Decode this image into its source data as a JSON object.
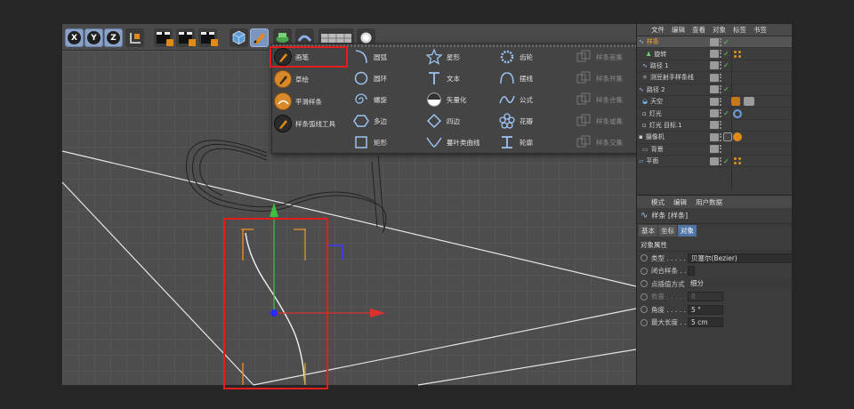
{
  "toolbar": {
    "axis_x": "X",
    "axis_y": "Y",
    "axis_z": "Z"
  },
  "spline_menu": {
    "col1": [
      "画笔",
      "草绘",
      "平滑样条",
      "样条弧线工具"
    ],
    "col2": [
      "圆弧",
      "圆环",
      "螺旋",
      "多边",
      "矩形"
    ],
    "col3": [
      "星形",
      "文本",
      "矢量化",
      "四边",
      "蔓叶类曲线"
    ],
    "col4": [
      "齿轮",
      "摆线",
      "公式",
      "花瓣",
      "轮廓"
    ],
    "col5": [
      "样条差集",
      "样条并集",
      "样条合集",
      "样条或集",
      "样条交集"
    ]
  },
  "object_manager": {
    "tabs": [
      "文件",
      "编辑",
      "查看",
      "对象",
      "标签",
      "书签"
    ],
    "objects": [
      {
        "name": "样条",
        "selected": true
      },
      {
        "name": "旋转"
      },
      {
        "name": "路径 1"
      },
      {
        "name": "测豆射手样条线"
      },
      {
        "name": "路径 2"
      },
      {
        "name": "天空"
      },
      {
        "name": "灯光"
      },
      {
        "name": "灯光 目标.1"
      },
      {
        "name": "摄像机"
      },
      {
        "name": "背景"
      },
      {
        "name": "平面"
      }
    ]
  },
  "attributes": {
    "tabs": [
      "模式",
      "编辑",
      "用户数据"
    ],
    "title": "样条 [样条]",
    "subtabs": [
      "基本",
      "坐标",
      "对象"
    ],
    "section": "对象属性",
    "props": [
      {
        "label": "类型 . . . . .",
        "value": "贝塞尔(Bezier)"
      },
      {
        "label": "闭合样条 . .",
        "value": ""
      },
      {
        "label": "点插值方式",
        "value": "细分"
      },
      {
        "label": "数量 . . . . .",
        "value": "8"
      },
      {
        "label": "角度 . . . . .",
        "value": "5 °"
      },
      {
        "label": "最大长度 . .",
        "value": "5 cm"
      }
    ]
  },
  "colors": {
    "highlight": "#e21d1d",
    "accent_orange": "#d88a2a",
    "selected_tab": "#4f74a6"
  }
}
